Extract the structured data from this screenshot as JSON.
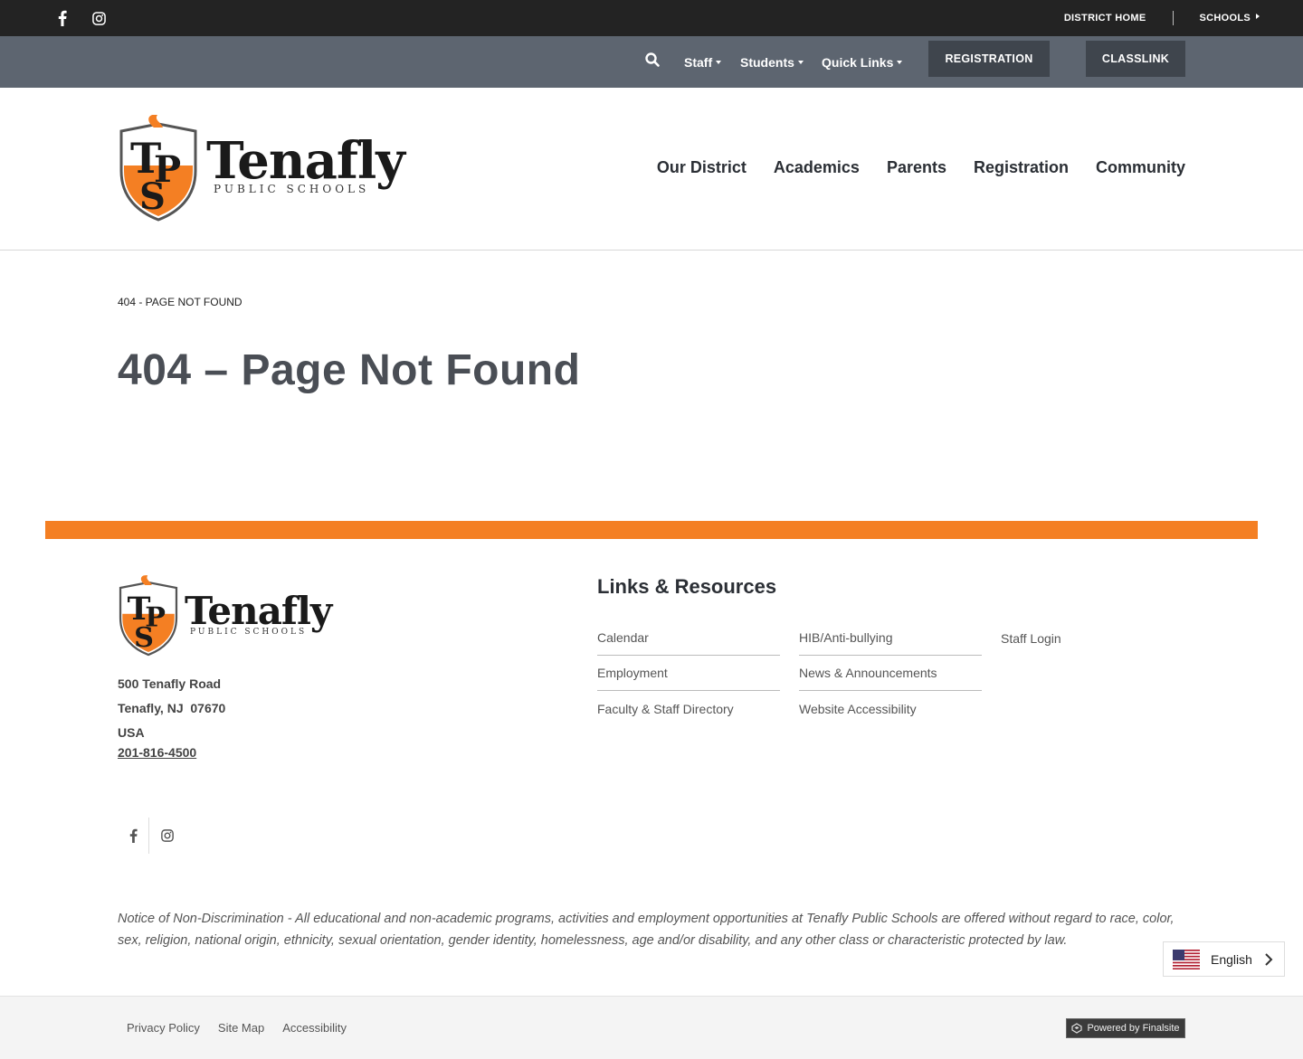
{
  "topbar": {
    "district_home": "DISTRICT HOME",
    "schools": "SCHOOLS"
  },
  "utility": {
    "staff": "Staff",
    "students": "Students",
    "quick_links": "Quick Links",
    "registration_btn": "REGISTRATION",
    "classlink_btn": "CLASSLINK"
  },
  "header": {
    "logo_word": "Tenafly",
    "logo_sub": "PUBLIC SCHOOLS",
    "nav": [
      "Our District",
      "Academics",
      "Parents",
      "Registration",
      "Community"
    ]
  },
  "content": {
    "breadcrumb": "404 - PAGE NOT FOUND",
    "title": "404 – Page Not Found"
  },
  "footer": {
    "address_line1": "500 Tenafly Road",
    "address_line2": "Tenafly, NJ  07670",
    "address_line3": "USA",
    "phone": "201-816-4500",
    "links_heading": "Links & Resources",
    "links": [
      "Calendar",
      "Employment",
      "Faculty & Staff Directory",
      "HIB/Anti-bullying",
      "News & Announcements",
      "Website Accessibility",
      "Staff Login"
    ],
    "notice": "Notice of Non-Discrimination - All educational and non-academic programs, activities and employment opportunities at Tenafly Public Schools are offered without regard to race, color, sex, religion, national origin, ethnicity, sexual orientation, gender identity, homelessness, age and/or disability, and any other class or characteristic protected by law.",
    "language": "English",
    "bottom_links": [
      "Privacy Policy",
      "Site Map",
      "Accessibility"
    ],
    "powered_by": "Powered by Finalsite"
  },
  "colors": {
    "accent_orange": "#f47f23",
    "topbar": "#232323",
    "utility_bar": "#5d6570",
    "button_dark": "#3f454d"
  },
  "icons": [
    "facebook-icon",
    "instagram-icon",
    "search-icon",
    "caret-down-icon",
    "caret-right-icon",
    "us-flag-icon",
    "chevron-right-icon",
    "finalsite-icon"
  ]
}
